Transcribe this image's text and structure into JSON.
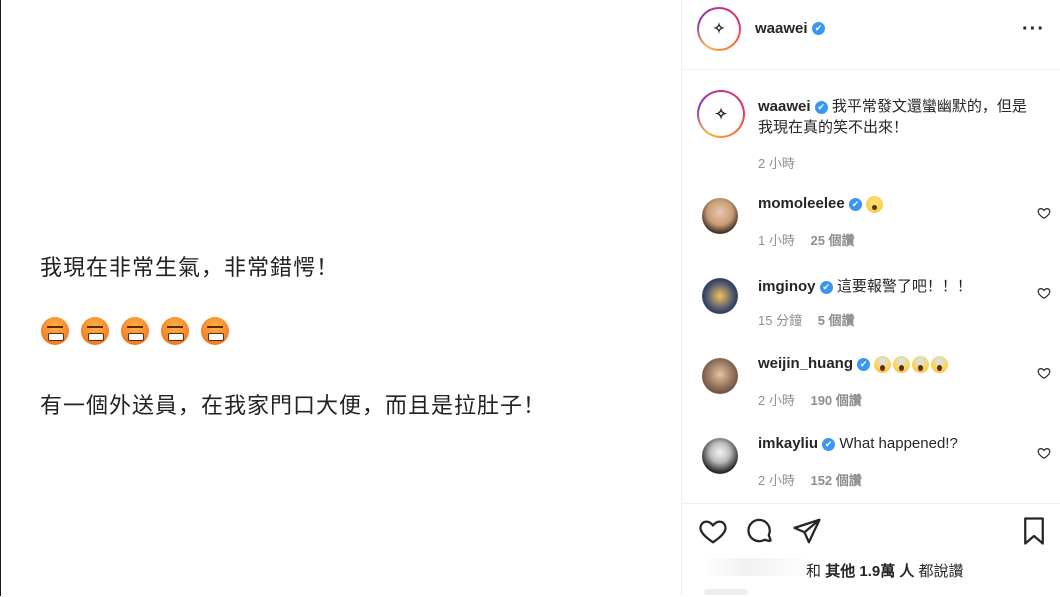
{
  "post": {
    "line1": "我現在非常生氣，非常錯愕！",
    "line2": "有一個外送員，在我家門口大便，而且是拉肚子！",
    "emoji_count": 5,
    "emoji_name": "angry-face"
  },
  "header": {
    "username": "waawei",
    "verified_mark": "✔",
    "more_label": "···"
  },
  "caption": {
    "username": "waawei",
    "text_line1": "我平常發文還蠻幽默的，但是",
    "text_line2": "我現在真的笑不出來！",
    "time": "2 小時"
  },
  "comments": [
    {
      "username": "momoleelee",
      "text": "",
      "emoji": "astonished-face",
      "time": "1 小時",
      "likes": "25 個讚"
    },
    {
      "username": "imginoy",
      "text": "這要報警了吧！！！",
      "emoji": "",
      "time": "15 分鐘",
      "likes": "5 個讚"
    },
    {
      "username": "weijin_huang",
      "text": "",
      "emoji": "screaming-face x4",
      "time": "2 小時",
      "likes": "190 個讚"
    },
    {
      "username": "imkayliu",
      "text": "What happened!?",
      "emoji": "",
      "time": "2 小時",
      "likes": "152 個讚"
    }
  ],
  "actions": {
    "like_icon": "heart-icon",
    "comment_icon": "comment-icon",
    "share_icon": "share-icon",
    "save_icon": "bookmark-icon",
    "likes_prefix": "和",
    "likes_others": "其他 1.9萬 人",
    "likes_suffix": "都說讚"
  },
  "colors": {
    "verified": "#3897f0",
    "meta": "#8e8e8e",
    "text": "#262626"
  }
}
